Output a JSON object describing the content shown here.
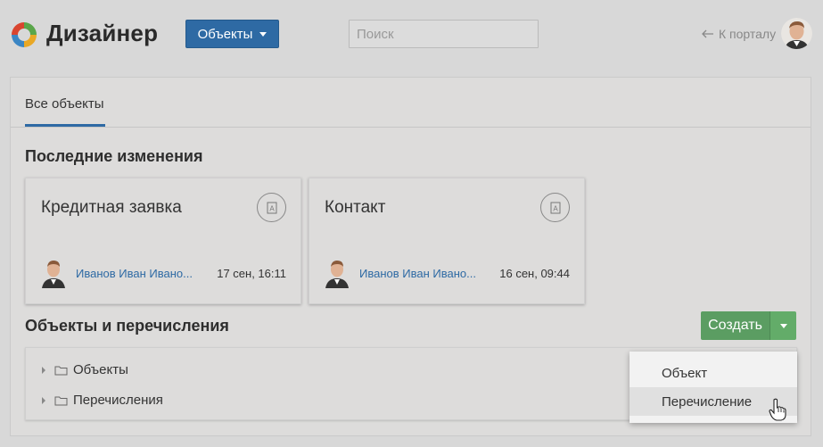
{
  "header": {
    "app_title": "Дизайнер",
    "objects_button": "Объекты",
    "search_placeholder": "Поиск",
    "portal_link": "К порталу"
  },
  "tabs": [
    {
      "label": "Все объекты",
      "active": true
    }
  ],
  "recent": {
    "title": "Последние изменения",
    "cards": [
      {
        "title": "Кредитная заявка",
        "author": "Иванов Иван Ивано...",
        "date": "17 сен, 16:11",
        "icon": "document-icon"
      },
      {
        "title": "Контакт",
        "author": "Иванов Иван Ивано...",
        "date": "16 сен, 09:44",
        "icon": "document-icon"
      }
    ]
  },
  "objects": {
    "title": "Объекты и перечисления",
    "create_button": "Создать",
    "tree": [
      {
        "label": "Объекты",
        "icon": "folder-icon"
      },
      {
        "label": "Перечисления",
        "icon": "folder-icon"
      }
    ]
  },
  "create_menu": {
    "items": [
      {
        "label": "Объект"
      },
      {
        "label": "Перечисление",
        "hovered": true
      }
    ]
  },
  "colors": {
    "primary": "#2e6aa4",
    "success": "#5b9d62",
    "background": "#d8d8d8"
  }
}
